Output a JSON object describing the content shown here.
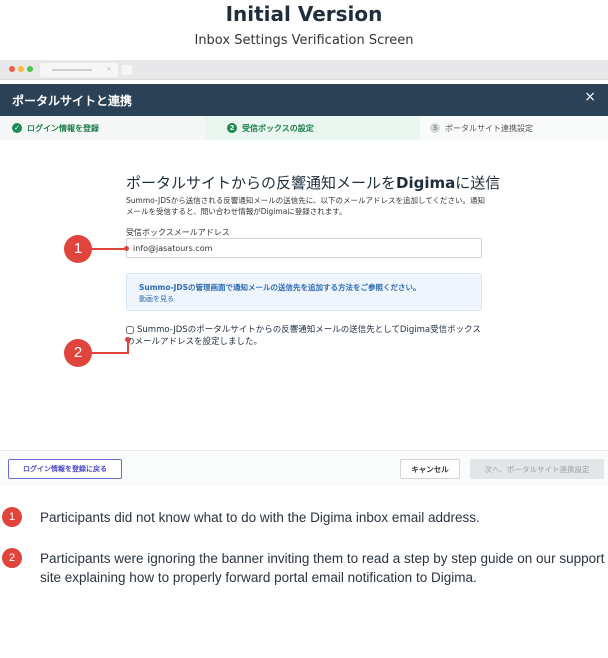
{
  "page": {
    "title": "Initial Version",
    "subtitle": "Inbox Settings Verification Screen"
  },
  "modal": {
    "title": "ポータルサイトと連携",
    "close_icon": "×"
  },
  "steps": [
    {
      "label": "ログイン情報を登録",
      "icon": "✓",
      "state": "done"
    },
    {
      "label": "受信ボックスの設定",
      "number": "2",
      "state": "active"
    },
    {
      "label": "ポータルサイト連携設定",
      "number": "3",
      "state": "inactive"
    }
  ],
  "content": {
    "heading_part1": "ポータルサイトからの反響通知メールを",
    "heading_brand": "Digima",
    "heading_part2": "に送信",
    "description": "Summo-JDSから送信される反響通知メールの送信先に、以下のメールアドレスを追加してください。通知メールを受信すると、問い合わせ情報がDigimaに登録されます。",
    "field_label": "受信ボックスメールアドレス",
    "email_value": "info@jasatours.com",
    "banner_text": "Summo-JDSの管理画面で通知メールの送信先を追加する方法をご参照ください。",
    "banner_link": "動画を見る",
    "confirm_text": "Summo-JDSのポータルサイトからの反響通知メールの送信先としてDigima受信ボックスのメールアドレスを設定しました。"
  },
  "markers": [
    "1",
    "2"
  ],
  "footer": {
    "back_label": "ログイン情報を登録に戻る",
    "cancel_label": "キャンセル",
    "next_label": "次へ、ポータルサイト連携設定"
  },
  "notes": [
    {
      "number": "1",
      "text": "Participants did not know what to do with the Digima inbox email address."
    },
    {
      "number": "2",
      "text": "Participants were ignoring the banner inviting them to read a step by step guide on our support site explaining how to properly forward portal email notification to Digima."
    }
  ],
  "colors": {
    "header_bg": "#2b4256",
    "accent_green": "#1d8a52",
    "marker_red": "#e0443c",
    "link_blue": "#2f6bb3"
  }
}
